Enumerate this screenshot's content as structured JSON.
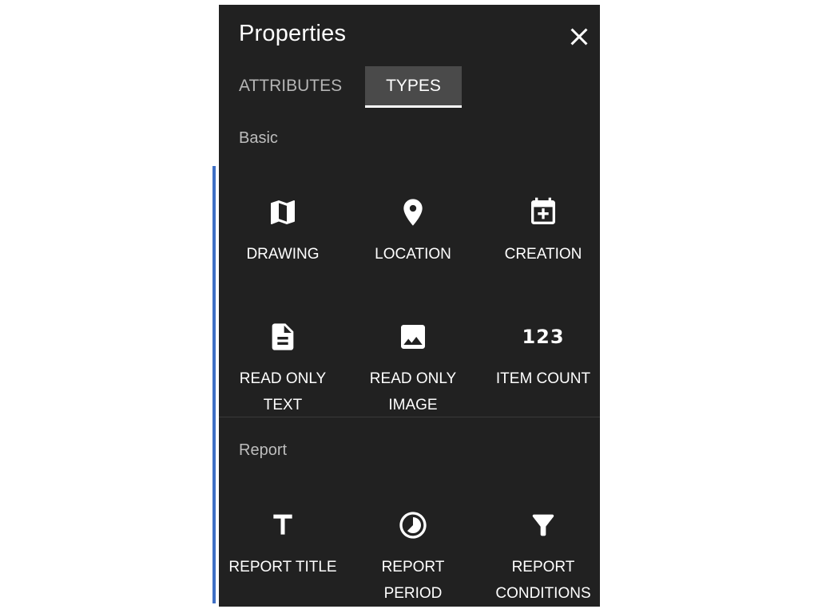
{
  "panel": {
    "title": "Properties",
    "tabs": [
      {
        "label": "ATTRIBUTES",
        "active": false
      },
      {
        "label": "TYPES",
        "active": true
      }
    ]
  },
  "sections": [
    {
      "label": "Basic",
      "items": [
        {
          "label": "DRAWING",
          "icon": "map-icon"
        },
        {
          "label": "LOCATION",
          "icon": "location-pin-icon"
        },
        {
          "label": "CREATION",
          "icon": "calendar-add-icon"
        },
        {
          "label": "READ ONLY\nTEXT",
          "icon": "document-icon"
        },
        {
          "label": "READ ONLY\nIMAGE",
          "icon": "image-icon"
        },
        {
          "label": "ITEM COUNT",
          "icon": "number-icon",
          "icon_text": "123"
        }
      ]
    },
    {
      "label": "Report",
      "items": [
        {
          "label": "REPORT TITLE",
          "icon": "text-title-icon"
        },
        {
          "label": "REPORT\nPERIOD",
          "icon": "timelapse-icon"
        },
        {
          "label": "REPORT\nCONDITIONS",
          "icon": "filter-icon"
        }
      ]
    }
  ],
  "colors": {
    "panel_bg": "#212121",
    "tab_active_bg": "#4a4a4a",
    "accent_line": "#3f6fc4"
  }
}
